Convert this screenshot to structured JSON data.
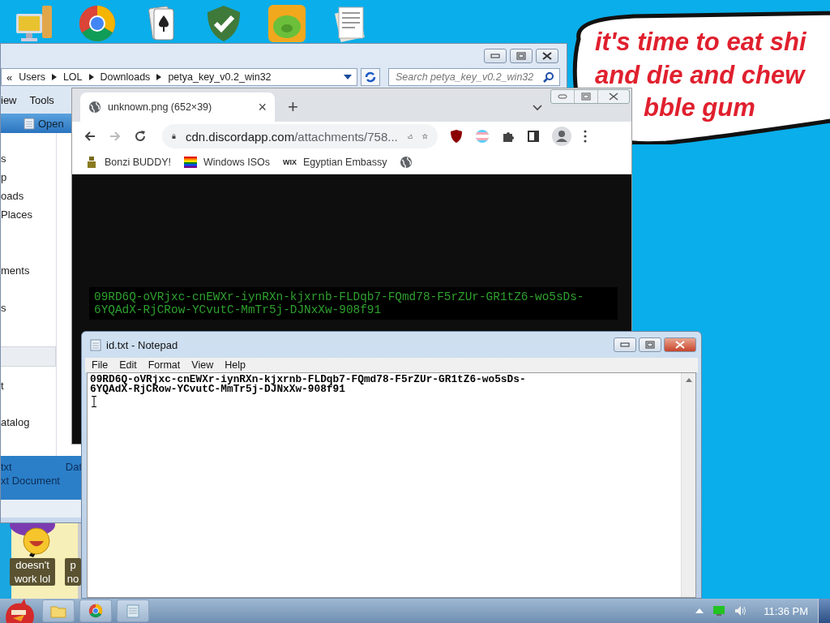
{
  "desktop_icons": [
    {
      "kind": "computer"
    },
    {
      "kind": "chrome"
    },
    {
      "kind": "cards"
    },
    {
      "kind": "shield"
    },
    {
      "kind": "game"
    },
    {
      "kind": "document"
    }
  ],
  "speech_bubble": {
    "lines": [
      "it's time to eat shi",
      "and die and chew",
      "bble gum"
    ]
  },
  "explorer": {
    "breadcrumb_prefix": "«",
    "breadcrumb": [
      "Users",
      "LOL",
      "Downloads",
      "petya_key_v0.2_win32"
    ],
    "search": {
      "placeholder": "Search petya_key_v0.2_win32"
    },
    "menu": [
      "iew",
      "Tools"
    ],
    "toolbar": [
      "Open"
    ],
    "nav_items": [
      {
        "label": "s",
        "selected": false
      },
      {
        "label": "p",
        "selected": false
      },
      {
        "label": "oads",
        "selected": false
      },
      {
        "label": "Places",
        "selected": false
      },
      {
        "label": "ments",
        "selected": false
      },
      {
        "label": "s",
        "selected": false
      },
      {
        "selected": true
      },
      {
        "label": "t",
        "selected": false
      },
      {
        "label": "atalog",
        "selected": false
      }
    ],
    "file": {
      "name": "txt",
      "column_2": "Dat",
      "type": "xt Document",
      "selected": true
    }
  },
  "chrome": {
    "tab": {
      "title": "unknown.png (652×39)",
      "close": "×"
    },
    "new_tab": "+",
    "url": {
      "host": "cdn.discordapp.com",
      "path": "/attachments/758..."
    },
    "bookmarks": [
      {
        "kind": "bonzi",
        "label": "Bonzi BUDDY!"
      },
      {
        "kind": "rainbow",
        "label": "Windows ISOs"
      },
      {
        "kind": "wix",
        "icon_text": "WIX",
        "label": "Egyptian Embassy"
      },
      {
        "kind": "globe"
      }
    ],
    "image_lines": [
      "09RD6Q-oVRjxc-cnEWXr-iynRXn-kjxrnb-FLDqb7-FQmd78-F5rZUr-GR1tZ6-wo5sDs-",
      "6YQAdX-RjCRow-YCvutC-MmTr5j-DJNxXw-908f91"
    ]
  },
  "notepad": {
    "title": "id.txt - Notepad",
    "menu": [
      "File",
      "Edit",
      "Format",
      "View",
      "Help"
    ],
    "lines": [
      "09RD6Q-oVRjxc-cnEWXr-iynRXn-kjxrnb-FLDqb7-FQmd78-F5rZUr-GR1tZ6-wo5sDs-",
      "6YQAdX-RjCRow-YCvutC-MmTr5j-DJNxXw-908f91"
    ]
  },
  "desktop_labels": [
    "doesn't work lol",
    "p no"
  ],
  "taskbar": {
    "apps": [
      {
        "kind": "folder"
      },
      {
        "kind": "chrome"
      },
      {
        "kind": "notepad"
      }
    ],
    "clock": "11:36 PM"
  }
}
